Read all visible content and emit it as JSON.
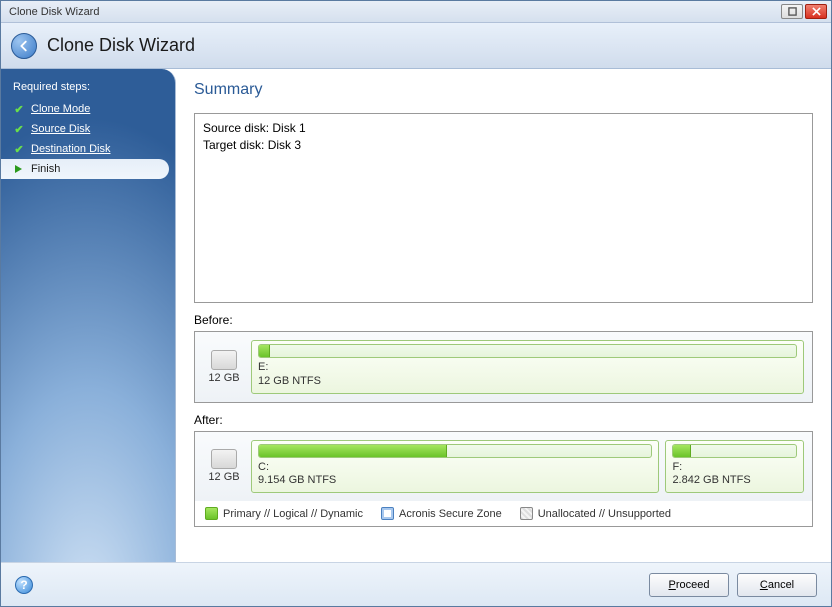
{
  "window": {
    "title": "Clone Disk Wizard"
  },
  "header": {
    "title": "Clone Disk Wizard"
  },
  "sidebar": {
    "heading": "Required steps:",
    "steps": [
      {
        "label": "Clone Mode",
        "state": "done"
      },
      {
        "label": "Source Disk",
        "state": "done"
      },
      {
        "label": "Destination Disk",
        "state": "done"
      },
      {
        "label": "Finish",
        "state": "current"
      }
    ]
  },
  "main": {
    "title": "Summary",
    "source_line": "Source disk: Disk 1",
    "target_line": "Target disk: Disk 3",
    "before_label": "Before:",
    "after_label": "After:",
    "before": {
      "disk_size": "12 GB",
      "partitions": [
        {
          "letter": "E:",
          "desc": "12 GB  NTFS",
          "fill_pct": 2,
          "width_pct": 100
        }
      ]
    },
    "after": {
      "disk_size": "12 GB",
      "partitions": [
        {
          "letter": "C:",
          "desc": "9.154 GB  NTFS",
          "fill_pct": 48,
          "width_pct": 76
        },
        {
          "letter": "F:",
          "desc": "2.842 GB  NTFS",
          "fill_pct": 14,
          "width_pct": 24
        }
      ]
    },
    "legend": {
      "primary": "Primary // Logical // Dynamic",
      "secure": "Acronis Secure Zone",
      "unalloc": "Unallocated // Unsupported"
    }
  },
  "footer": {
    "proceed": "Proceed",
    "cancel": "Cancel"
  }
}
